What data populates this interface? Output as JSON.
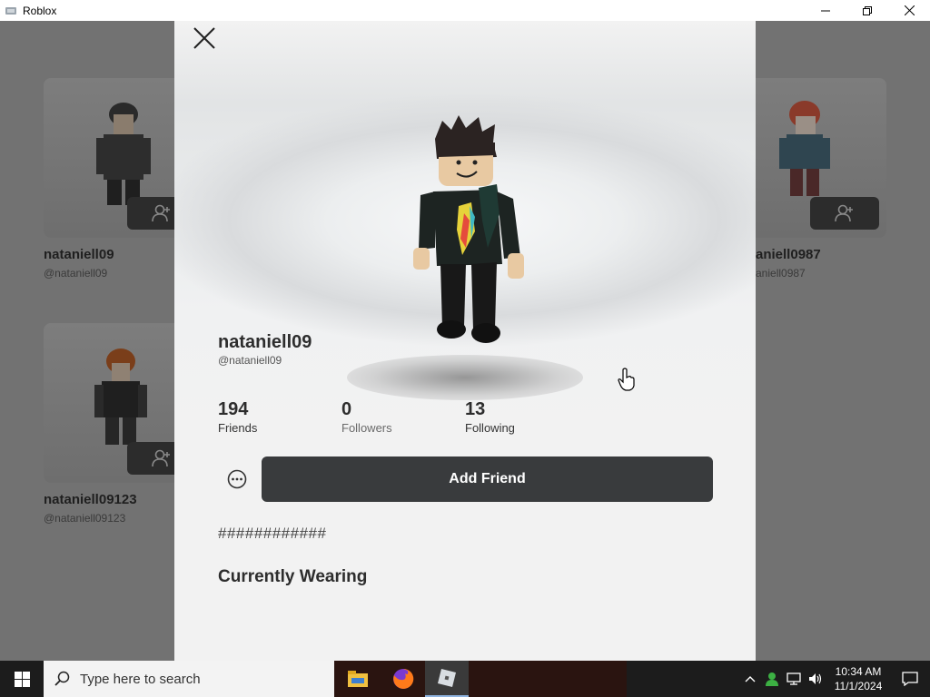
{
  "window": {
    "title": "Roblox"
  },
  "background_cards": [
    {
      "name": "nataniell09",
      "handle": "@nataniell09"
    },
    {
      "name": "aniell0987",
      "handle": "aniell0987"
    },
    {
      "name": "nataniell09123",
      "handle": "@nataniell09123"
    }
  ],
  "profile": {
    "display_name": "nataniell09",
    "handle": "@nataniell09",
    "stats": [
      {
        "value": "194",
        "label": "Friends"
      },
      {
        "value": "0",
        "label": "Followers"
      },
      {
        "value": "13",
        "label": "Following"
      }
    ],
    "add_friend_label": "Add Friend",
    "about": "############",
    "currently_wearing_heading": "Currently Wearing"
  },
  "taskbar": {
    "search_placeholder": "Type here to search",
    "time": "10:34 AM",
    "date": "11/1/2024"
  },
  "icons": {
    "close": "close-icon",
    "more": "more-options-icon",
    "add_friend_small": "add-friend-icon",
    "start": "windows-start-icon",
    "search": "search-icon",
    "file_explorer": "file-explorer-icon",
    "firefox": "firefox-icon",
    "roblox": "roblox-icon"
  },
  "colors": {
    "primary_button": "#393b3d",
    "modal_bg": "#f2f2f2",
    "backdrop": "#727272",
    "taskbar": "#1c1c1c"
  }
}
